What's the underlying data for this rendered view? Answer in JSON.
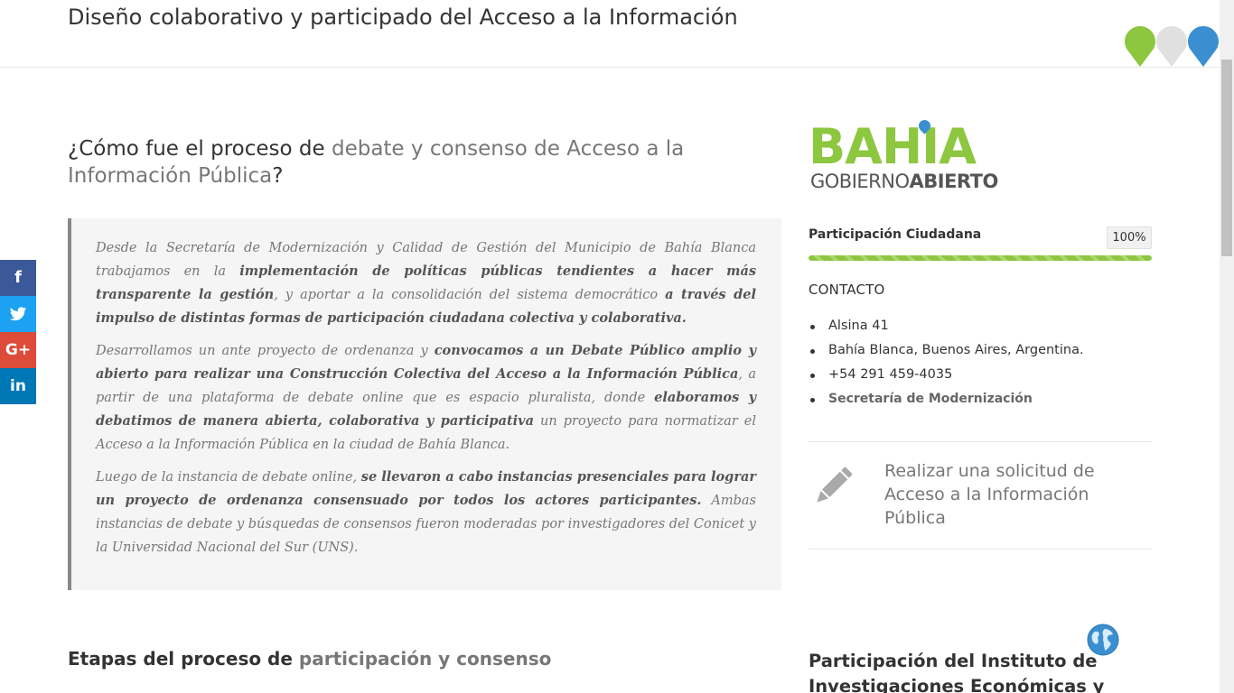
{
  "header": {
    "title": "Diseño colaborativo y participado del Acceso a la Información"
  },
  "share": {
    "facebook": "f",
    "twitter": "t",
    "google_plus": "G+",
    "linkedin": "in"
  },
  "main": {
    "section_title_prefix": "¿Cómo fue el proceso de ",
    "section_title_highlight": "debate y consenso de Acceso a la Información Pública",
    "section_title_suffix": "?",
    "quote": {
      "p1_a": "Desde la Secretaría de Modernización y Calidad de Gestión del Municipio de Bahía Blanca trabajamos en la ",
      "p1_b": "implementación de políticas públicas tendientes a hacer más transparente la gestión",
      "p1_c": ", y aportar a la consolidación del sistema democrático ",
      "p1_d": "a través del impulso de distintas formas de participación ciudadana colectiva y colaborativa.",
      "p2_a": "Desarrollamos un ante proyecto de ordenanza y ",
      "p2_b": "convocamos a un Debate Público amplio y abierto para realizar una Construcción Colectiva del Acceso a la Información Pública",
      "p2_c": ", a partir de una plataforma de debate online que es espacio pluralista, donde ",
      "p2_d": "elaboramos y debatimos de manera abierta, colaborativa y participativa",
      "p2_e": " un proyecto para normatizar el Acceso a la Información Pública en la ciudad de Bahía Blanca.",
      "p3_a": "Luego de la instancia de debate online, ",
      "p3_b": "se llevaron a cabo instancias presenciales para lograr un proyecto de ordenanza consensuado por todos los actores participantes.",
      "p3_c": " Ambas instancias de debate y búsquedas de consensos fueron moderadas por investigadores del Conicet y la Universidad Nacional del Sur (UNS)."
    },
    "stages_title_prefix": "Etapas del proceso de ",
    "stages_title_highlight": "participación y consenso"
  },
  "sidebar": {
    "logo": {
      "main": "BAHIA",
      "sub_light": "GOBIERNO",
      "sub_bold": "ABIERTO"
    },
    "progress": {
      "label": "Participación Ciudadana",
      "value_text": "100%",
      "value": 1.0
    },
    "contact": {
      "title": "CONTACTO",
      "items": [
        "Alsina 41",
        "Bahía Blanca, Buenos Aires, Argentina.",
        "+54 291  459-4035"
      ],
      "link": "Secretaría de Modernización"
    },
    "request": {
      "text": "Realizar una solicitud de Acceso a la Información Pública"
    },
    "institute_title": "Participación del Instituto de Investigaciones Económicas y Sociales"
  },
  "colors": {
    "brand_green": "#8dc63f",
    "brand_blue": "#3b8fd0",
    "pin_gray": "#e0e0e0"
  },
  "icons": {
    "pins": "map-pins-logo",
    "pencil": "pencil-icon",
    "globe": "globe-icon"
  }
}
